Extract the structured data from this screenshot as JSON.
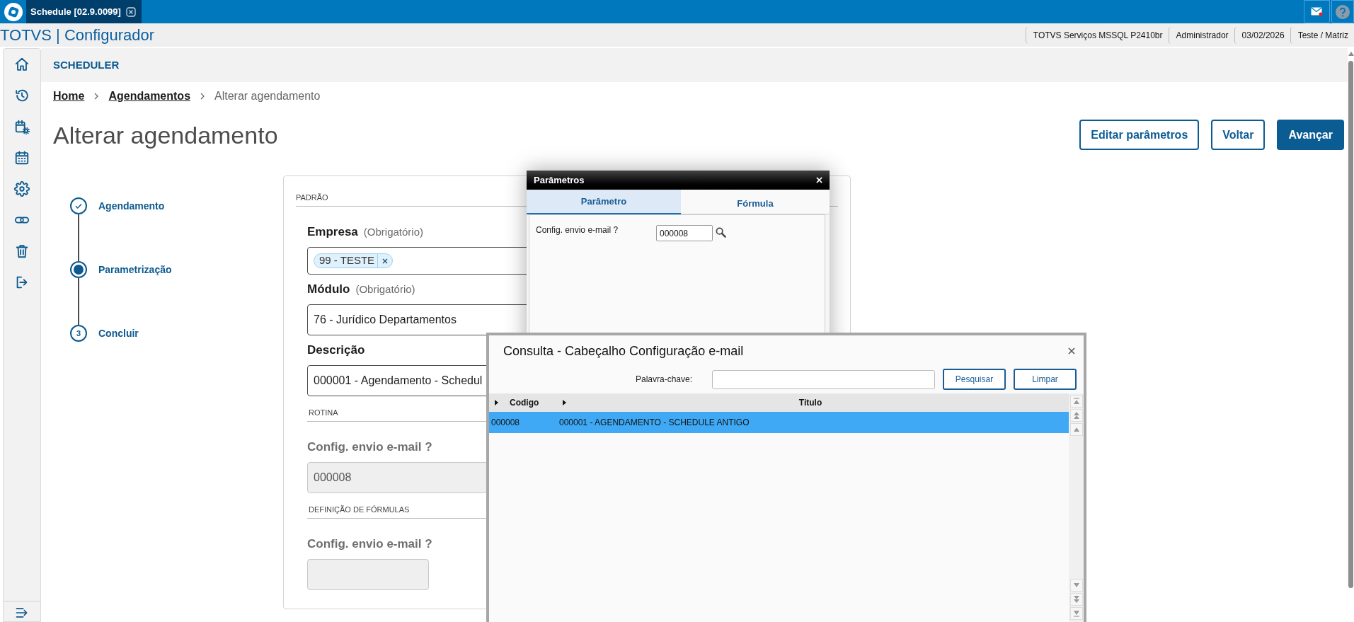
{
  "app_bar": {
    "tabs": [
      {
        "label": "Schedule [02.9.0099]",
        "selected": true
      }
    ],
    "mail_unread": true
  },
  "header": {
    "title": "TOTVS | Configurador",
    "info": [
      "TOTVS Serviços MSSQL P2410br",
      "Administrador",
      "03/02/2026",
      "Teste / Matriz"
    ]
  },
  "module_title": "SCHEDULER",
  "breadcrumb": [
    {
      "label": "Home",
      "kind": "link"
    },
    {
      "label": "Agendamentos",
      "kind": "link"
    },
    {
      "label": "Alterar agendamento",
      "kind": "current"
    }
  ],
  "page_title": "Alterar agendamento",
  "actions": [
    {
      "label": "Editar parâmetros",
      "kind": "secondary"
    },
    {
      "label": "Voltar",
      "kind": "secondary"
    },
    {
      "label": "Avançar",
      "kind": "primary"
    }
  ],
  "stepper": [
    {
      "label": "Agendamento",
      "completed": true,
      "current": false
    },
    {
      "label": "Parametrização",
      "completed": false,
      "current": true
    },
    {
      "label": "Concluir",
      "completed": false,
      "current": false,
      "number": "3"
    }
  ],
  "form": {
    "title": "PADRÃO",
    "items": [
      {
        "kind": "chips",
        "label": "Empresa",
        "note": "(Obrigatório)",
        "chips": [
          "99 - TESTE"
        ],
        "disabled": false
      },
      {
        "kind": "field",
        "label": "Módulo",
        "note": "(Obrigatório)",
        "value": "76 - Jurídico Departamentos",
        "disabled": false
      },
      {
        "kind": "field",
        "label": "Descrição",
        "value": "000001 - Agendamento - Schedul",
        "disabled": false
      },
      {
        "kind": "section",
        "title": "ROTINA"
      },
      {
        "kind": "field",
        "label": "Config. envio e-mail ?",
        "value": "000008",
        "disabled": true
      },
      {
        "kind": "section",
        "title": "DEFINIÇÃO DE FÓRMULAS"
      },
      {
        "kind": "formula",
        "label": "Config. envio e-mail ?",
        "disabled": true
      }
    ]
  },
  "params_dialog": {
    "title": "Parâmetros",
    "tabs": [
      {
        "label": "Parâmetro",
        "selected": true
      },
      {
        "label": "Fórmula",
        "selected": false
      }
    ],
    "rows": [
      {
        "label": "Config. envio e-mail ?",
        "value": "000008"
      }
    ]
  },
  "lookup_dialog": {
    "title": "Consulta - Cabeçalho Configuração e-mail",
    "search_label": "Palavra-chave:",
    "buttons": [
      "Pesquisar",
      "Limpar"
    ],
    "columns": [
      "Codigo",
      "Titulo"
    ],
    "rows": [
      {
        "cells": [
          "000008",
          "000001 - AGENDAMENTO - SCHEDULE ANTIGO"
        ],
        "selected": true
      }
    ]
  }
}
